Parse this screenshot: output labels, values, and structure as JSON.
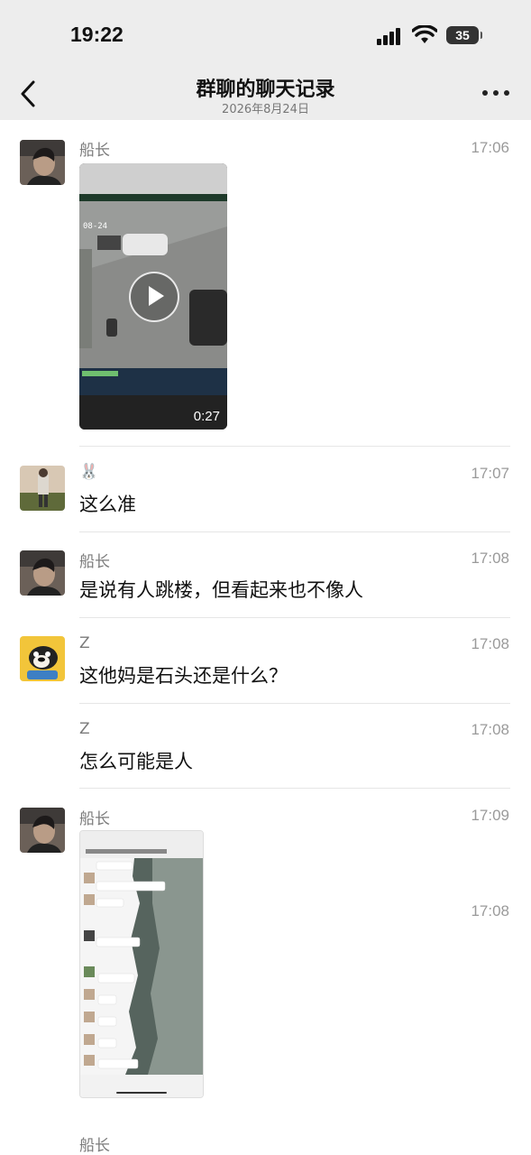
{
  "status": {
    "time": "19:22",
    "battery": "35"
  },
  "nav": {
    "title": "群聊的聊天记录",
    "subtitle": "2026年8月24日"
  },
  "messages": [
    {
      "sender": "船长",
      "time": "17:06",
      "video_duration": "0:27"
    },
    {
      "sender": "🐰",
      "time": "17:07",
      "text": "这么准"
    },
    {
      "sender": "船长",
      "time": "17:08",
      "text": "是说有人跳楼，但看起来也不像人"
    },
    {
      "sender": "Z",
      "time": "17:08",
      "text": "这他妈是石头还是什么？"
    },
    {
      "sender": "Z",
      "time": "17:08",
      "text": "怎么可能是人"
    },
    {
      "sender": "船长",
      "time": "17:09"
    },
    {
      "sender": "船长"
    }
  ],
  "overlay_time": "17:08",
  "colors": {
    "nav_bg": "#ededed",
    "text": "#111111",
    "meta": "#9a9a9a"
  }
}
